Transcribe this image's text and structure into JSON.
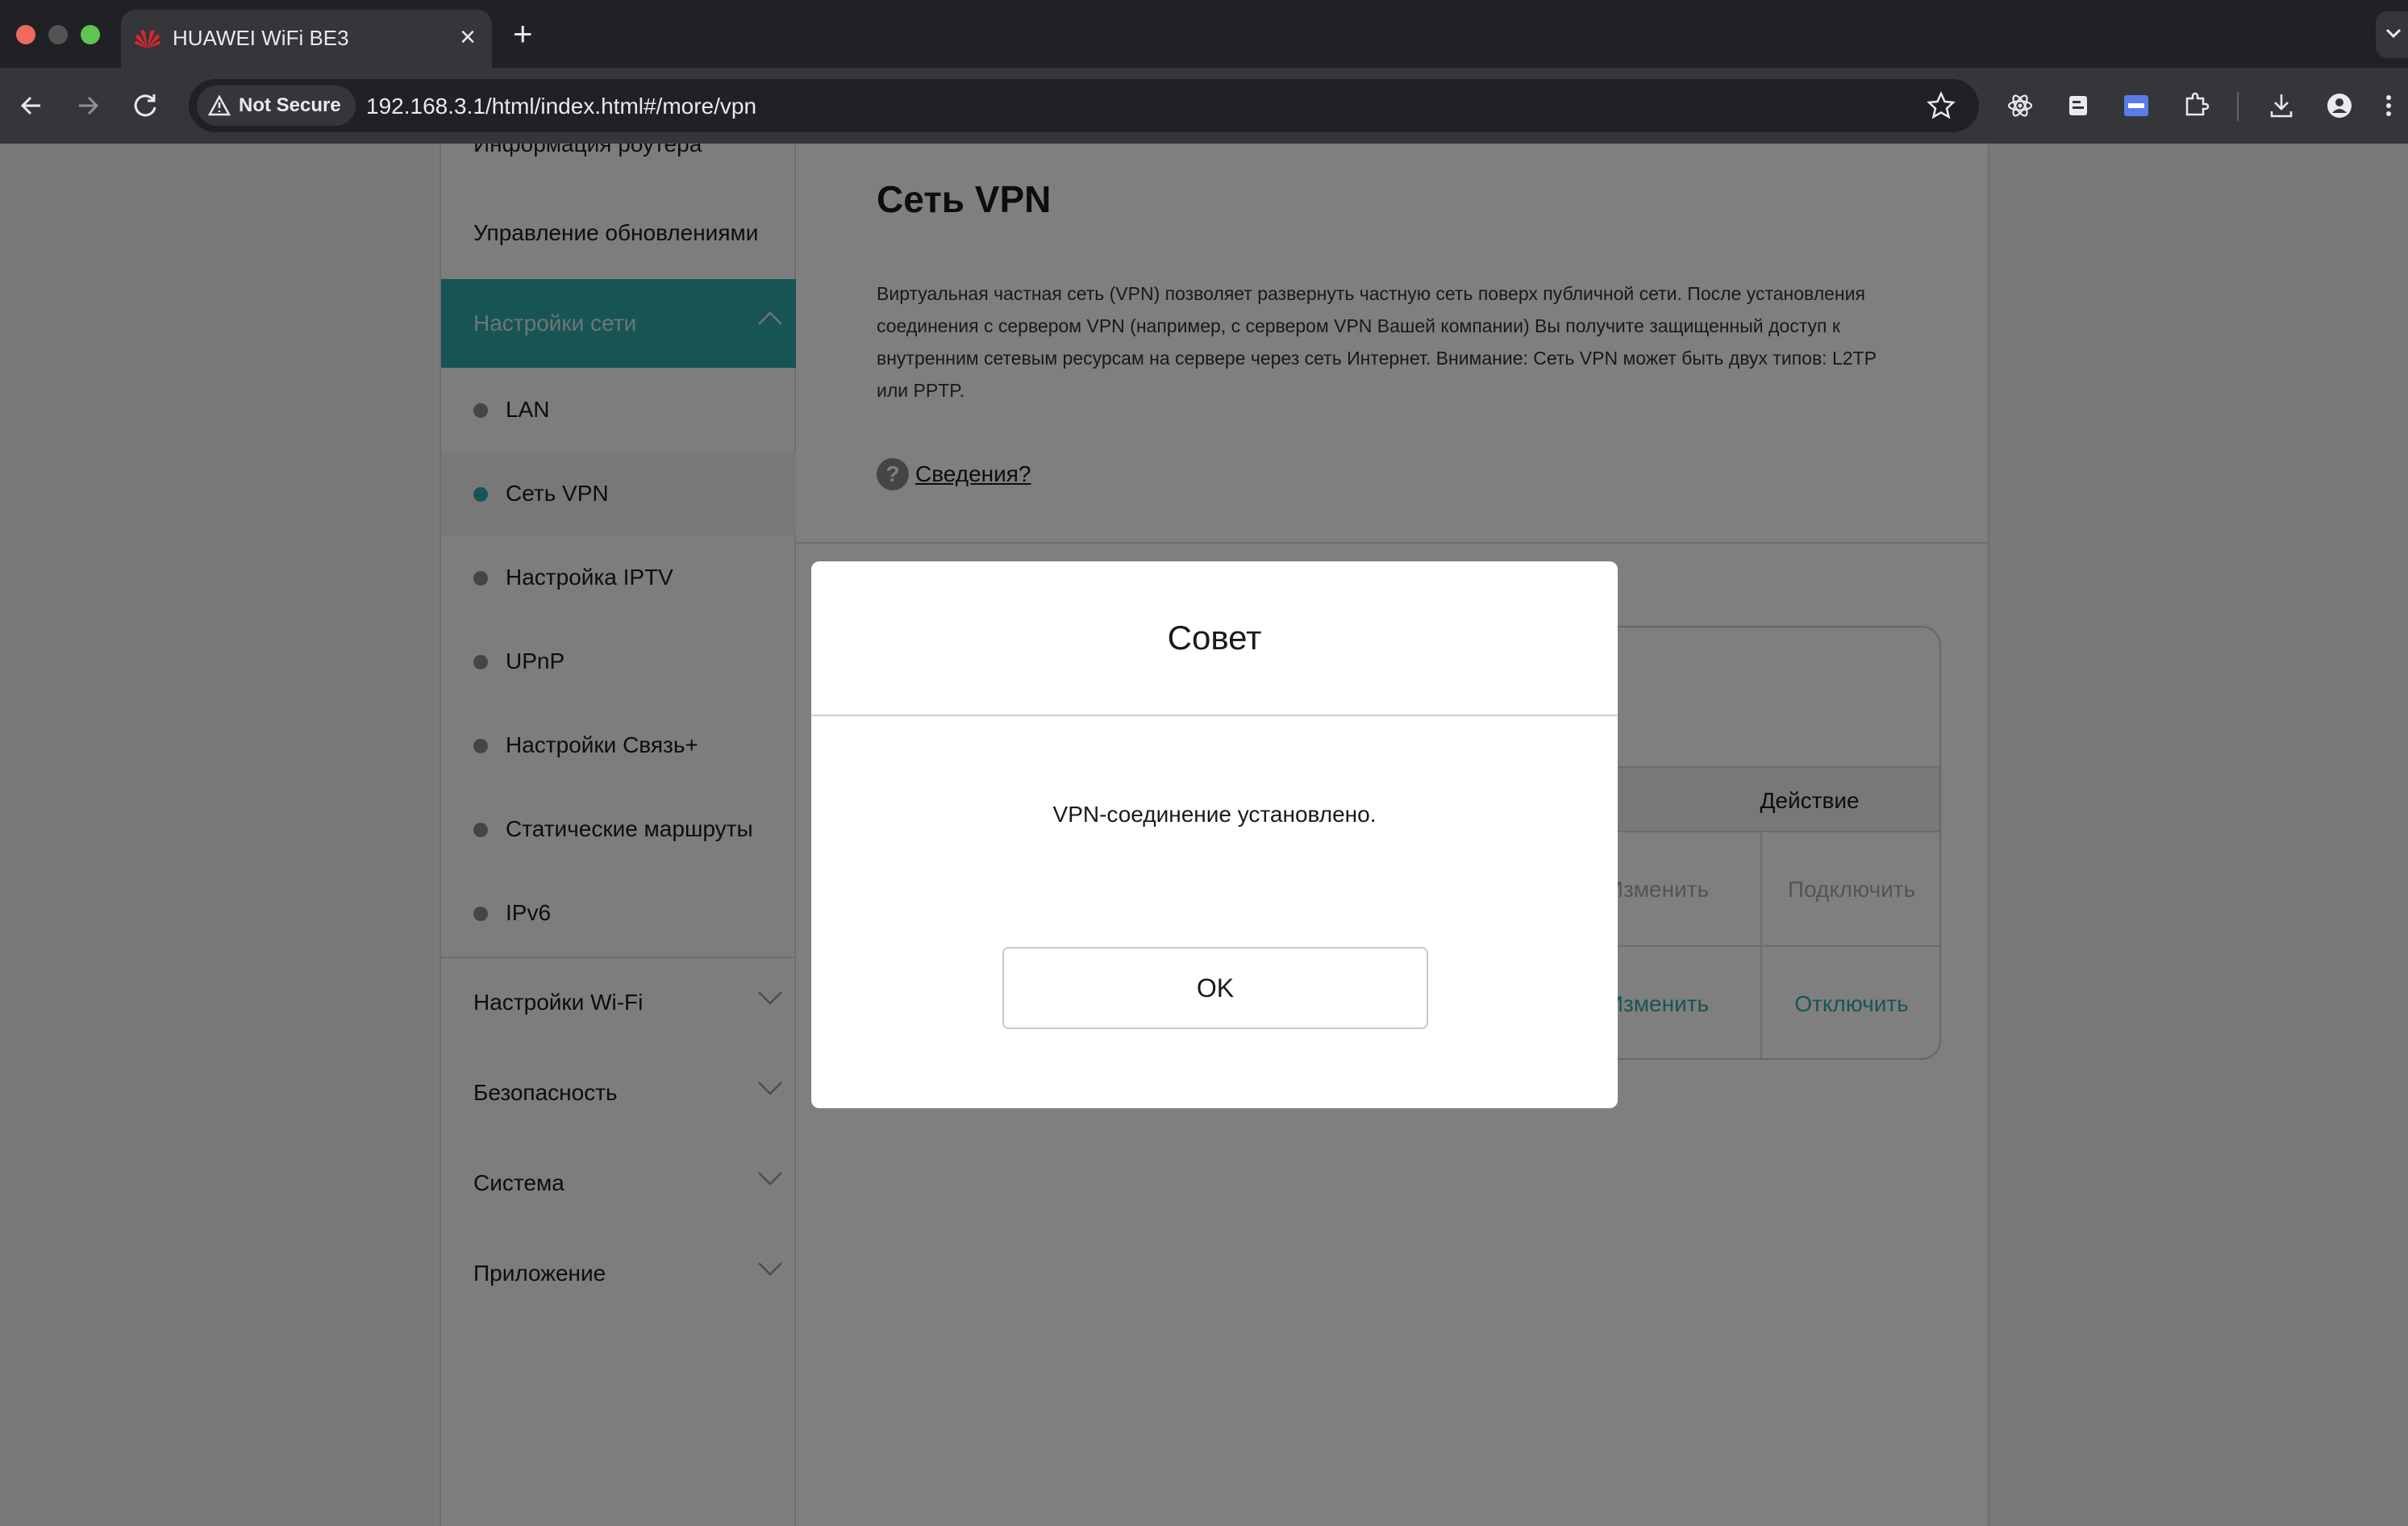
{
  "browser": {
    "tab_title": "HUAWEI WiFi BE3",
    "tab_close": "×",
    "new_tab": "+",
    "security_label": "Not Secure",
    "url": "192.168.3.1/html/index.html#/more/vpn"
  },
  "sidebar": {
    "router_info_label": "Информация роутера",
    "updates_label": "Управление обновлениями",
    "network_group_label": "Настройки сети",
    "network_items": [
      {
        "label": "LAN"
      },
      {
        "label": "Сеть VPN"
      },
      {
        "label": "Настройка IPTV"
      },
      {
        "label": "UPnP"
      },
      {
        "label": "Настройки Связь+"
      },
      {
        "label": "Статические маршруты"
      },
      {
        "label": "IPv6"
      }
    ],
    "groups": [
      {
        "label": "Настройки Wi-Fi"
      },
      {
        "label": "Безопасность"
      },
      {
        "label": "Система"
      },
      {
        "label": "Приложение"
      }
    ]
  },
  "content": {
    "title": "Сеть VPN",
    "description": "Виртуальная частная сеть (VPN) позволяет развернуть частную сеть поверх публичной сети. После установления соединения с сервером VPN (например, с сервером VPN Вашей компании) Вы получите защищенный доступ к внутренним сетевым ресурсам на сервере через сеть Интернет. Внимание: Сеть VPN может быть двух типов: L2TP или PPTP.",
    "info_icon": "?",
    "info_link": "Сведения?",
    "table": {
      "action_header": "Действие",
      "rows": [
        {
          "edit": "Изменить",
          "toggle": "Подключить"
        },
        {
          "edit": "Изменить",
          "toggle": "Отключить"
        }
      ]
    }
  },
  "modal": {
    "title": "Совет",
    "message": "VPN-соединение установлено.",
    "ok_label": "OK"
  }
}
